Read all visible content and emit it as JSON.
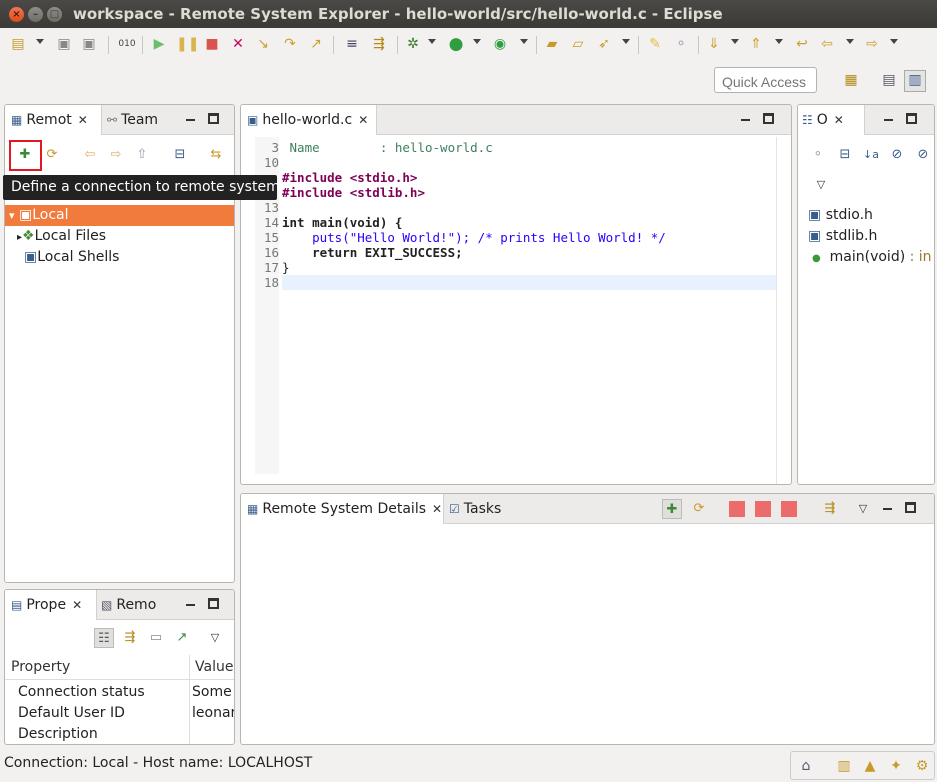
{
  "window": {
    "title": "workspace - Remote System Explorer - hello-world/src/hello-world.c - Eclipse"
  },
  "quick_access": {
    "placeholder": "Quick Access"
  },
  "remote_panel": {
    "tabs": [
      {
        "label": "Remot"
      },
      {
        "label": "Team"
      }
    ],
    "tooltip": "Define a connection to remote system",
    "tree": [
      {
        "label": "Local"
      },
      {
        "label": "Local Files"
      },
      {
        "label": "Local Shells"
      }
    ]
  },
  "editor": {
    "tab": "hello-world.c",
    "lines": [
      {
        "num": "3",
        "text": " Name        : hello-world.c"
      },
      {
        "num": "10",
        "text": ""
      },
      {
        "num": "",
        "text": "#include <stdio.h>"
      },
      {
        "num": "",
        "text": "#include <stdlib.h>"
      },
      {
        "num": "13",
        "text": ""
      },
      {
        "num": "14",
        "text": "int main(void) {"
      },
      {
        "num": "15",
        "text": "    puts(\"Hello World!\"); /* prints Hello World! */"
      },
      {
        "num": "16",
        "text": "    return EXIT_SUCCESS;"
      },
      {
        "num": "17",
        "text": "}"
      },
      {
        "num": "18",
        "text": ""
      }
    ]
  },
  "outline": {
    "tab": "O",
    "items": [
      {
        "label": "stdio.h"
      },
      {
        "label": "stdlib.h"
      },
      {
        "label": "main(void)",
        "suffix": " : in"
      }
    ]
  },
  "properties": {
    "tabs": [
      {
        "label": "Prope"
      },
      {
        "label": "Remo"
      }
    ],
    "columns": [
      "Property",
      "Value"
    ],
    "rows": [
      {
        "property": "Connection status",
        "value": "Some"
      },
      {
        "property": "Default User ID",
        "value": "leonar"
      },
      {
        "property": "Description",
        "value": ""
      }
    ]
  },
  "details": {
    "tabs": [
      {
        "label": "Remote System Details"
      },
      {
        "label": "Tasks"
      }
    ]
  },
  "status_bar": {
    "text": "Connection: Local - Host name: LOCALHOST"
  }
}
